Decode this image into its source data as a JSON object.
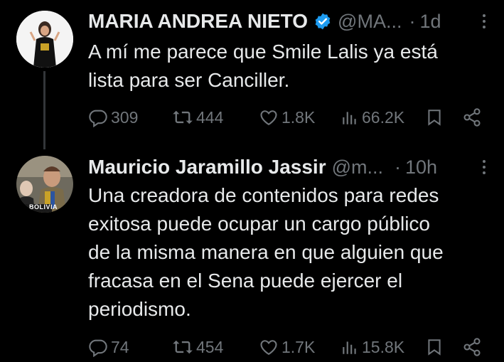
{
  "tweets": [
    {
      "name": "MARIA ANDREA NIETO",
      "handle": "@MA...",
      "time": "1d",
      "text": "A mí me parece que Smile Lalis ya está\nlista para ser Canciller.",
      "replies": "309",
      "reposts": "444",
      "likes": "1.8K",
      "views": "66.2K",
      "verified": true
    },
    {
      "name": "Mauricio Jaramillo Jassir",
      "handle": "@m...",
      "time": "10h",
      "text": "Una creadora de contenidos para redes\nexitosa puede ocupar un cargo público\nde la misma manera en que alguien que\nfracasa en el Sena puede ejercer el\nperiodismo.",
      "replies": "74",
      "reposts": "454",
      "likes": "1.7K",
      "views": "15.8K",
      "avatar_caption": "BOLIVIA"
    }
  ],
  "colors": {
    "background": "#000000",
    "text": "#e7e9ea",
    "muted": "#71767b",
    "verified": "#1d9bf0"
  },
  "icons": [
    "reply-icon",
    "repost-icon",
    "like-icon",
    "views-icon",
    "bookmark-icon",
    "share-icon",
    "more-icon",
    "verified-badge-icon"
  ]
}
